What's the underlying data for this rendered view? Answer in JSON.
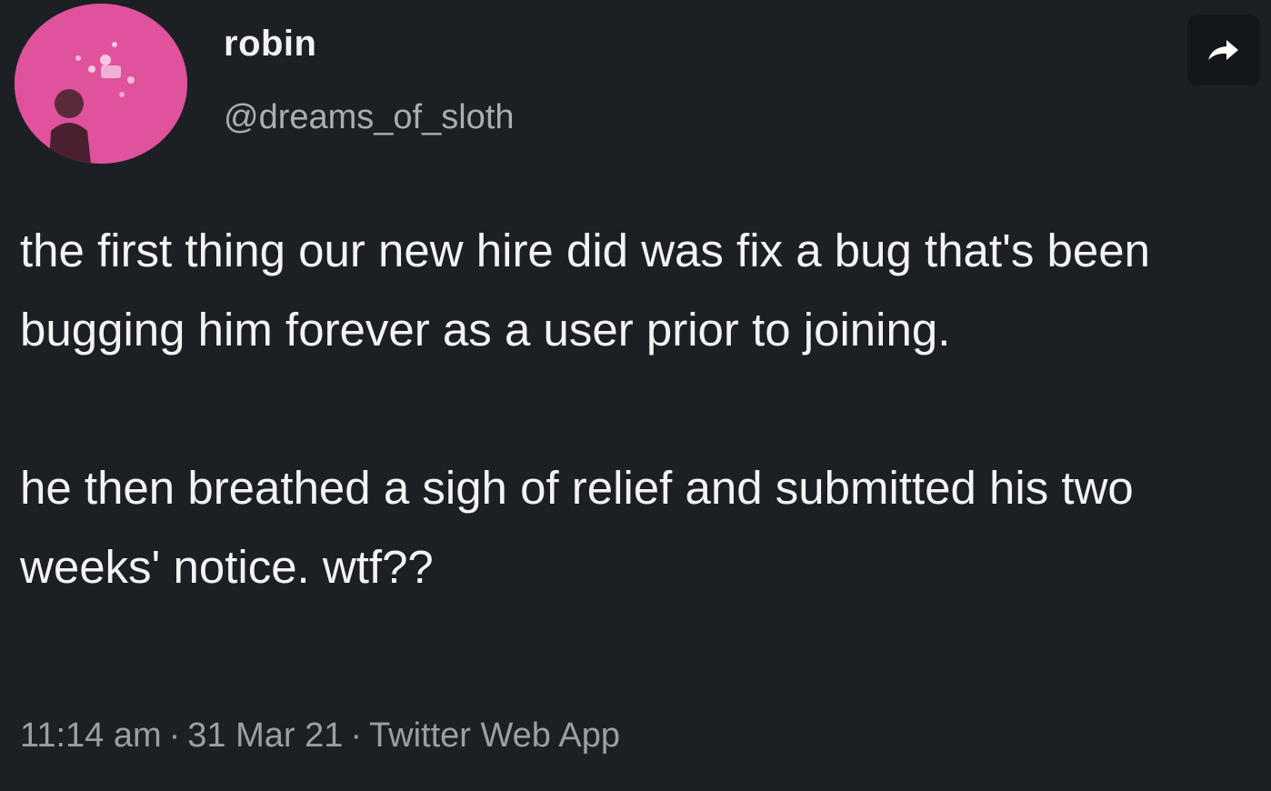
{
  "user": {
    "display_name": "robin",
    "handle": "@dreams_of_sloth",
    "avatar_icon": "profile-avatar",
    "avatar_color": "#e0529c"
  },
  "actions": {
    "share_icon": "share-arrow-icon"
  },
  "tweet": {
    "paragraphs": [
      "the first thing our new hire did was fix a bug that's been bugging him forever as a user prior to joining.",
      "he then breathed a sigh of relief and submitted his two weeks' notice. wtf??"
    ],
    "time": "11:14 am",
    "date": "31 Mar 21",
    "separator": "·",
    "source": "Twitter Web App"
  },
  "colors": {
    "background": "#1c2024",
    "text": "#f2f3f4",
    "muted": "#9aa0a6"
  }
}
